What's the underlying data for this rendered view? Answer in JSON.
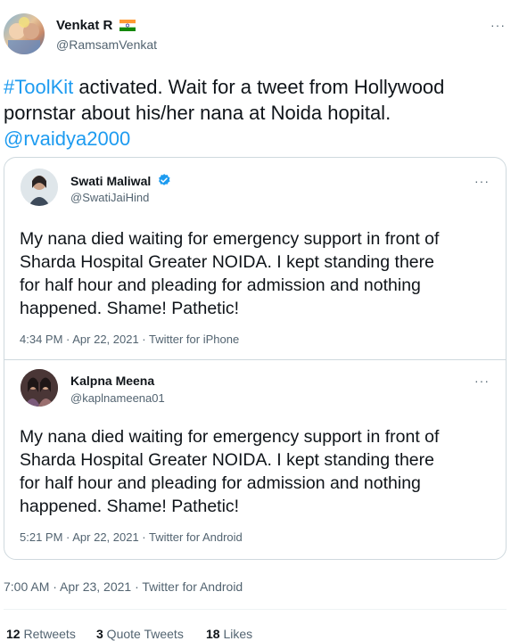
{
  "tweet": {
    "author_name": "Venkat R",
    "author_handle": "@RamsamVenkat",
    "hashtag": "#ToolKit",
    "text_line1_rest": " activated. Wait for a tweet from Hollywood",
    "text_line2": "pornstar about his/her nana at Noida hopital.",
    "mention": "@rvaidya2000",
    "more_label": "···",
    "timestamp": "7:00 AM · Apr 23, 2021 · Twitter for Android"
  },
  "quotes": [
    {
      "author_name": "Swati Maliwal",
      "author_handle": "@SwatiJaiHind",
      "verified": true,
      "lines": [
        "My nana died waiting for emergency support in front of",
        "Sharda Hospital Greater NOIDA. I kept standing there",
        "for half hour and pleading for admission and nothing",
        "happened. Shame! Pathetic!"
      ],
      "timestamp": "4:34 PM · Apr 22, 2021 · Twitter for iPhone",
      "more_label": "···"
    },
    {
      "author_name": "Kalpna Meena",
      "author_handle": "@kaplnameena01",
      "verified": false,
      "lines": [
        "My nana died waiting for emergency support in front of",
        "Sharda Hospital Greater NOIDA. I kept standing there",
        "for half hour and pleading for admission and nothing",
        "happened. Shame! Pathetic!"
      ],
      "timestamp": "5:21 PM · Apr 22, 2021 · Twitter for Android",
      "more_label": "···"
    }
  ],
  "stats": {
    "retweets_count": "12",
    "retweets_label": " Retweets",
    "quotes_count": "3",
    "quotes_label": " Quote Tweets",
    "likes_count": "18",
    "likes_label": " Likes"
  },
  "colors": {
    "accent": "#1d9bf0",
    "secondary_text": "#536471",
    "border": "#cfd9de"
  }
}
